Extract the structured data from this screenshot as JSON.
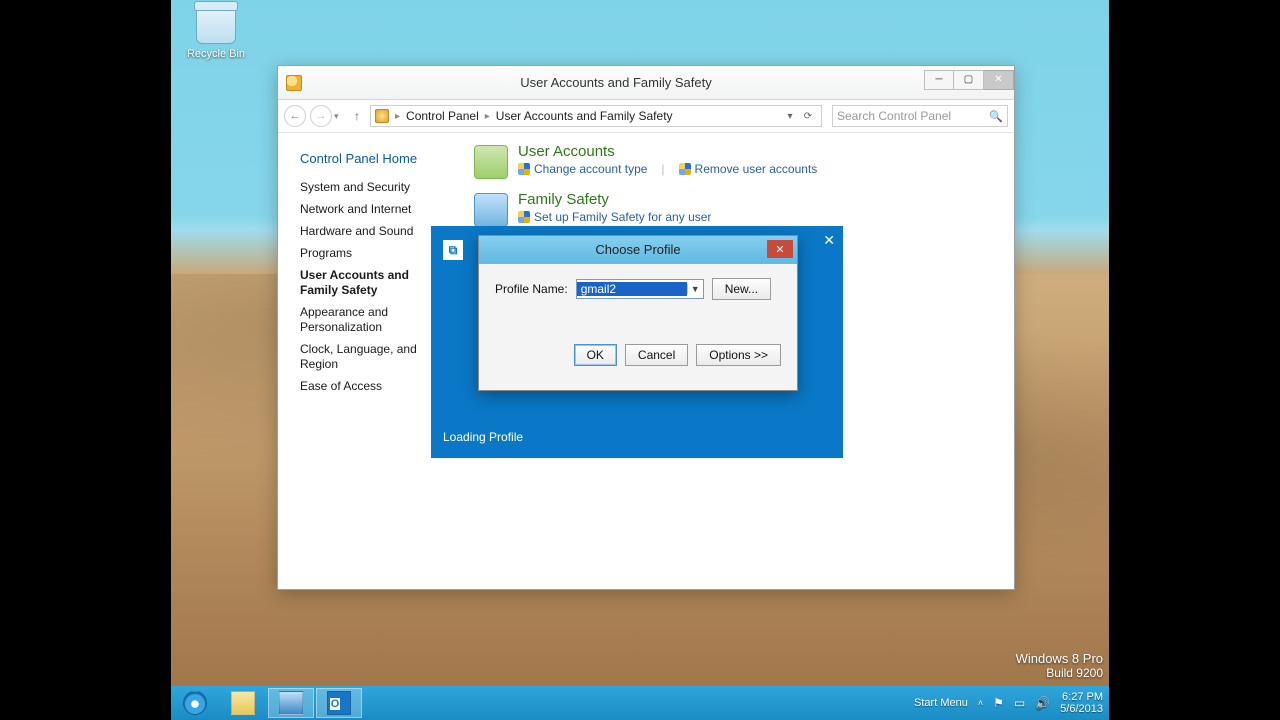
{
  "desktop": {
    "recycle_label": "Recycle Bin"
  },
  "cp": {
    "title": "User Accounts and Family Safety",
    "breadcrumb": {
      "a": "Control Panel",
      "b": "User Accounts and Family Safety"
    },
    "search_placeholder": "Search Control Panel",
    "sidebar": {
      "home": "Control Panel Home",
      "items": [
        "System and Security",
        "Network and Internet",
        "Hardware and Sound",
        "Programs",
        "User Accounts and Family Safety",
        "Appearance and Personalization",
        "Clock, Language, and Region",
        "Ease of Access"
      ]
    },
    "groups": {
      "ua": {
        "title": "User Accounts",
        "link1": "Change account type",
        "link2": "Remove user accounts"
      },
      "fs": {
        "title": "Family Safety",
        "link1": "Set up Family Safety for any user"
      }
    }
  },
  "splash": {
    "loading": "Loading Profile"
  },
  "dialog": {
    "title": "Choose Profile",
    "label": "Profile Name:",
    "value": "gmail2",
    "new": "New...",
    "ok": "OK",
    "cancel": "Cancel",
    "options": "Options >>"
  },
  "taskbar": {
    "start": "Start Menu",
    "time": "6:27 PM",
    "date": "5/6/2013"
  },
  "watermark": {
    "l1": "Windows 8 Pro",
    "l2": "Build 9200"
  }
}
